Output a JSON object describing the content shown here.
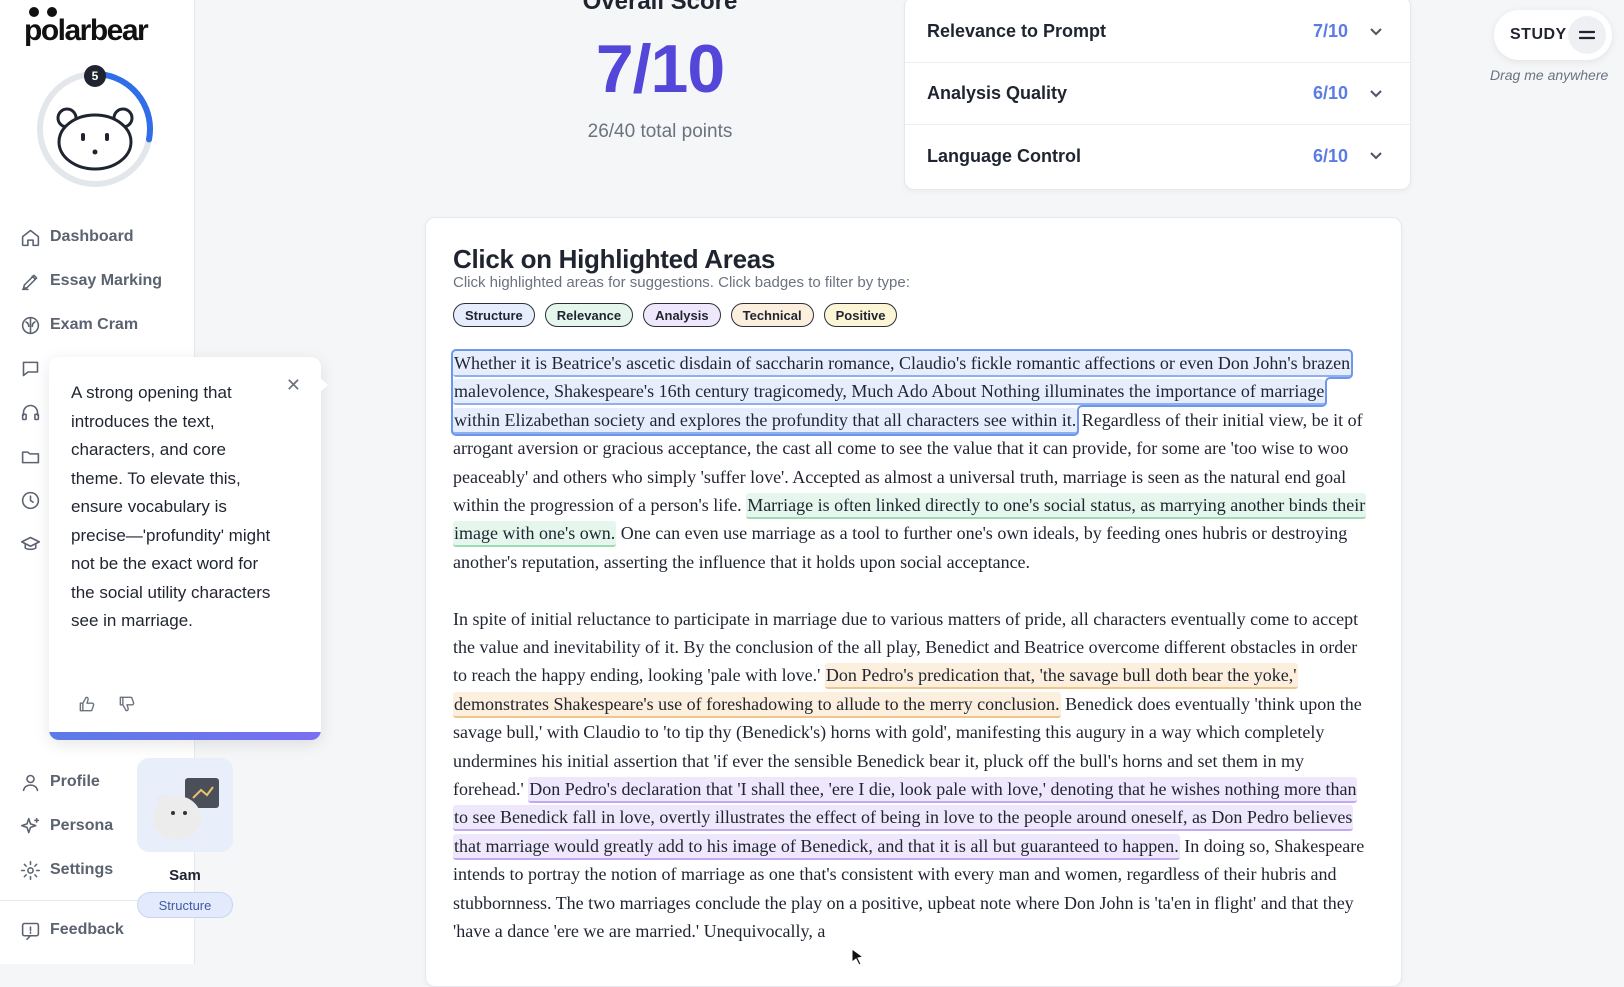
{
  "app": {
    "logo_text": "polarbear"
  },
  "progress": {
    "badge_count": "5",
    "ring_fraction": 0.28,
    "accent": "#2f6ee8"
  },
  "sidebar": {
    "items": [
      {
        "label": "Dashboard",
        "icon": "home-icon"
      },
      {
        "label": "Essay Marking",
        "icon": "pen-icon"
      },
      {
        "label": "Exam Cram",
        "icon": "brain-icon"
      },
      {
        "label": "Profile",
        "icon": "user-icon"
      },
      {
        "label": "Persona",
        "icon": "sparkles-icon"
      },
      {
        "label": "Settings",
        "icon": "gear-icon"
      },
      {
        "label": "Feedback",
        "icon": "feedback-icon"
      }
    ]
  },
  "tooltip": {
    "text": "A strong opening that introduces the text, characters, and core theme. To elevate this, ensure vocabulary is precise—'profundity' might not be the exact word for the social utility characters see in marriage."
  },
  "persona": {
    "name": "Sam",
    "tag": "Structure"
  },
  "score": {
    "title": "Overall Score",
    "value": "7/10",
    "total": "26/40 total points"
  },
  "criteria": [
    {
      "label": "Relevance to Prompt",
      "score": "7/10"
    },
    {
      "label": "Analysis Quality",
      "score": "6/10"
    },
    {
      "label": "Language Control",
      "score": "6/10"
    }
  ],
  "study": {
    "label": "STUDY",
    "hint": "Drag me anywhere"
  },
  "essay": {
    "title": "Click on Highlighted Areas",
    "subtitle": "Click highlighted areas for suggestions. Click badges to filter by type:",
    "badges": [
      {
        "label": "Structure",
        "color": "#e6eefd"
      },
      {
        "label": "Relevance",
        "color": "#e5f7ec"
      },
      {
        "label": "Analysis",
        "color": "#efe8fc"
      },
      {
        "label": "Technical",
        "color": "#fcefdd"
      },
      {
        "label": "Positive",
        "color": "#fdf6d6"
      }
    ],
    "p1": {
      "hl1": "Whether it is Beatrice's ascetic disdain of saccharin romance, Claudio's fickle romantic affections or even Don John's brazen malevolence, Shakespeare's 16th century tragicomedy, Much Ado About Nothing illuminates the importance of marriage within Elizabethan society and explores the profundity that all characters see within it.",
      "t1": " Regardless of their initial view, be it of arrogant aversion or gracious acceptance, the cast all come to see the value that it can provide, for some are 'too wise to woo peaceably' and others who simply 'suffer love'. Accepted as almost a universal truth, marriage is seen as the natural end goal within the progression of a person's life. ",
      "hl2": "Marriage is often linked directly to one's social status, as marrying another binds their image with one's own.",
      "t2": " One can even use marriage as a tool to further one's own ideals, by feeding ones hubris or destroying another's reputation, asserting the influence that it holds upon social acceptance."
    },
    "p2": {
      "t1": "In spite of initial reluctance to participate in marriage due to various matters of pride, all characters eventually come to accept the value and inevitability of it. By the conclusion of the all play, Benedict and Beatrice overcome different obstacles in order to reach the happy ending, looking 'pale with love.' ",
      "hl1": "Don Pedro's predication that, 'the savage bull doth bear the yoke,' demonstrates Shakespeare's use of foreshadowing to allude to the merry conclusion.",
      "t2": " Benedick does eventually 'think upon the savage bull,' with Claudio to 'to tip thy (Benedick's) horns with gold', manifesting this augury in a way which completely undermines his initial assertion that 'if ever the sensible Benedick bear it, pluck off the bull's horns and set them in my forehead.' ",
      "hl2": "Don Pedro's declaration that 'I shall thee, 'ere I die, look pale with love,' denoting that he wishes nothing more than to see Benedick fall in love, overtly illustrates the effect of being in love to the people around oneself, as Don Pedro believes that marriage would greatly add to his image of Benedick, and that it is all but guaranteed to happen.",
      "t3": " In doing so, Shakespeare intends to portray the notion of marriage as one that's consistent with every man and women, regardless of their hubris and stubbornness. The two marriages conclude the play on a positive, upbeat note where Don John is 'ta'en in flight' and that they 'have a dance 'ere we are married.' Unequivocally, a"
    }
  }
}
